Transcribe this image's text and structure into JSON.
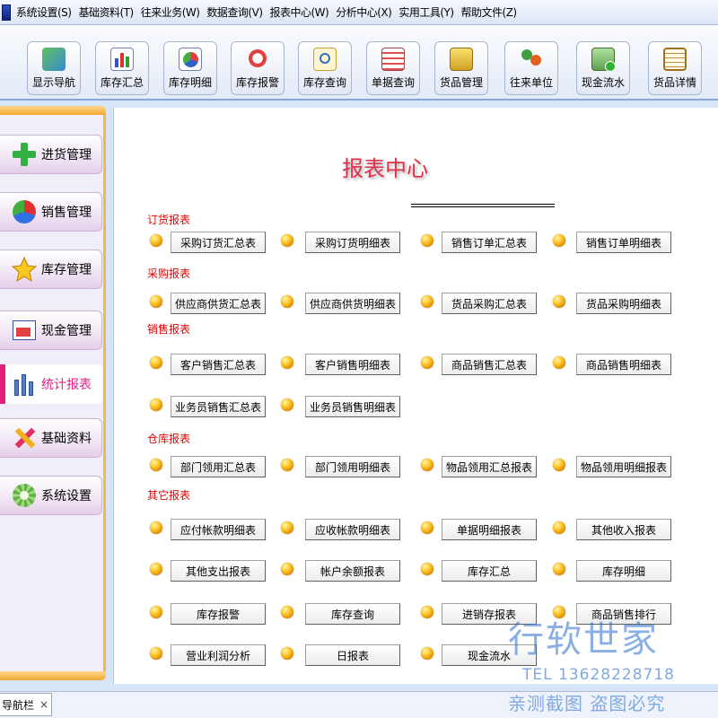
{
  "menu": [
    {
      "label": "系统设置(S)"
    },
    {
      "label": "基础资料(T)"
    },
    {
      "label": "往来业务(W)"
    },
    {
      "label": "数据查询(V)"
    },
    {
      "label": "报表中心(W)"
    },
    {
      "label": "分析中心(X)"
    },
    {
      "label": "实用工具(Y)"
    },
    {
      "label": "帮助文件(Z)"
    }
  ],
  "toolbar": [
    {
      "label": "显示导航",
      "icon": "map-icon"
    },
    {
      "label": "库存汇总",
      "icon": "bar-chart-icon"
    },
    {
      "label": "库存明细",
      "icon": "pie-chart-icon"
    },
    {
      "label": "库存报警",
      "icon": "alarm-icon"
    },
    {
      "label": "库存查询",
      "icon": "search-doc-icon"
    },
    {
      "label": "单据查询",
      "icon": "table-icon"
    },
    {
      "label": "货品管理",
      "icon": "goods-icon"
    },
    {
      "label": "往来单位",
      "icon": "people-icon"
    },
    {
      "label": "现金流水",
      "icon": "cash-icon"
    },
    {
      "label": "货品详情",
      "icon": "clipboard-icon"
    }
  ],
  "sidebar": [
    {
      "label": "进货管理",
      "icon": "plus-icon",
      "active": false
    },
    {
      "label": "销售管理",
      "icon": "pie-icon",
      "active": false
    },
    {
      "label": "库存管理",
      "icon": "star-icon",
      "active": false
    },
    {
      "label": "现金管理",
      "icon": "cash-chart-icon",
      "active": false
    },
    {
      "label": "统计报表",
      "icon": "stats-icon",
      "active": true
    },
    {
      "label": "基础资料",
      "icon": "tools-icon",
      "active": false
    },
    {
      "label": "系统设置",
      "icon": "gear-icon",
      "active": false
    }
  ],
  "main": {
    "title": "报表中心",
    "sections": [
      {
        "label": "订货报表",
        "rows": [
          [
            "采购订货汇总表",
            "采购订货明细表",
            "销售订单汇总表",
            "销售订单明细表"
          ]
        ]
      },
      {
        "label": "采购报表",
        "rows": [
          [
            "供应商供货汇总表",
            "供应商供货明细表",
            "货品采购汇总表",
            "货品采购明细表"
          ]
        ]
      },
      {
        "label": "销售报表",
        "rows": [
          [
            "客户销售汇总表",
            "客户销售明细表",
            "商品销售汇总表",
            "商品销售明细表"
          ],
          [
            "业务员销售汇总表",
            "业务员销售明细表"
          ]
        ]
      },
      {
        "label": "仓库报表",
        "rows": [
          [
            "部门领用汇总表",
            "部门领用明细表",
            "物品领用汇总报表",
            "物品领用明细报表"
          ]
        ]
      },
      {
        "label": "其它报表",
        "rows": [
          [
            "应付帐款明细表",
            "应收帐款明细表",
            "单据明细报表",
            "其他收入报表"
          ],
          [
            "其他支出报表",
            "帐户余额报表",
            "库存汇总",
            "库存明细"
          ],
          [
            "库存报警",
            "库存查询",
            "进销存报表",
            "商品销售排行"
          ],
          [
            "营业利润分析",
            "日报表",
            "现金流水"
          ]
        ]
      }
    ]
  },
  "bottom_tab": {
    "label": "导航栏",
    "close": "×"
  },
  "watermark": {
    "brand": "行软世家",
    "tel": "TEL  13628228718",
    "slogan": "亲测截图 盗图必究"
  }
}
